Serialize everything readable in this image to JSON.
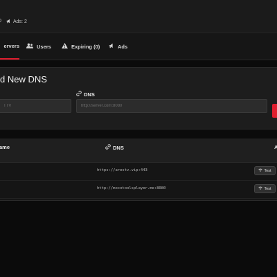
{
  "header": {
    "stat_partial": "0",
    "ads_label": "Ads: 2"
  },
  "tabs": [
    {
      "label": "Servers",
      "visible_label": "ervers",
      "icon": "server-icon",
      "active": true
    },
    {
      "label": "Users",
      "icon": "users-icon",
      "active": false
    },
    {
      "label": "Expiring (0)",
      "icon": "warning-icon",
      "active": false
    },
    {
      "label": "Ads",
      "icon": "megaphone-icon",
      "active": false
    }
  ],
  "add_form": {
    "title": "d New DNS",
    "name_placeholder": "TTV",
    "dns_label": "DNS",
    "dns_placeholder": "http://server.com:8080"
  },
  "table": {
    "col_name": "ame",
    "col_dns": "DNS",
    "col_actions": "A",
    "rows": [
      {
        "dns": "https://arestv.vip:443",
        "action": "Test"
      },
      {
        "dns": "http://mocotoolsplayer.me:8080",
        "action": "Test"
      }
    ]
  },
  "colors": {
    "accent": "#e11d2e",
    "background": "#0b0b0b",
    "card": "#1d1d1d",
    "input": "#2c2c2c"
  }
}
